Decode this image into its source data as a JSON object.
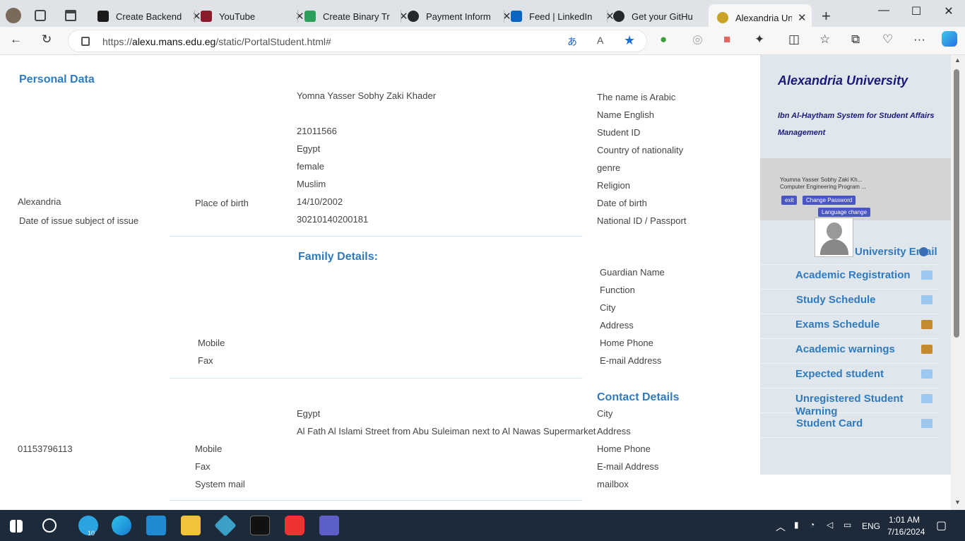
{
  "browser": {
    "tabs": [
      {
        "label": "Create Backend",
        "color": "#1b1b1b"
      },
      {
        "label": "YouTube",
        "color": "#e02020"
      },
      {
        "label": "Create Binary Tr",
        "color": "#2f9e5a"
      },
      {
        "label": "Payment Inform",
        "color": "#24292e"
      },
      {
        "label": "Feed | LinkedIn",
        "color": "#0a66c2"
      },
      {
        "label": "Get your GitHu",
        "color": "#24292e"
      },
      {
        "label": "Alexandria Univ",
        "color": "#c9a227"
      }
    ],
    "url_host": "alexu.mans.edu.eg",
    "url_prefix": "https://",
    "url_path": "/static/PortalStudent.html#"
  },
  "personal": {
    "heading": "Personal Data",
    "name_ar_value": "Yomna Yasser Sobhy Zaki Khader",
    "student_id": "21011566",
    "nationality": "Egypt",
    "gender": "female",
    "religion": "Muslim",
    "birth_date": "14/10/2002",
    "national_id": "30210140200181",
    "place_of_birth_value": "Alexandria",
    "labels": {
      "name_ar": "The name is Arabic",
      "name_en": "Name English",
      "student_id": "Student ID",
      "nationality": "Country of nationality",
      "genre": "genre",
      "religion": "Religion",
      "birth_date": "Date of birth",
      "national_id": "National ID / Passport",
      "place_of_birth": "Place of birth",
      "issue": "Date of issue subject of issue"
    }
  },
  "family": {
    "heading": "Family Details:",
    "labels": {
      "guardian": "Guardian Name",
      "function": "Function",
      "city": "City",
      "address": "Address",
      "home_phone": "Home Phone",
      "email": "E-mail Address",
      "mobile": "Mobile",
      "fax": "Fax"
    }
  },
  "contact": {
    "heading": "Contact Details",
    "city_value": "Egypt",
    "address_value": "Al Fath Al Islami Street from Abu Suleiman next to Al Nawas Supermarket",
    "mobile_value": "01153796113",
    "labels": {
      "city": "City",
      "address": "Address",
      "home_phone": "Home Phone",
      "email": "E-mail Address",
      "mailbox": "mailbox",
      "mobile": "Mobile",
      "fax": "Fax",
      "system_mail": "System mail"
    }
  },
  "sidebar": {
    "university": "Alexandria University",
    "system": "Ibn Al-Haytham System for Student Affairs Management",
    "user_name": "Youmna Yasser Sobhy Zaki Kh...",
    "program": "Computer Engineering Program ...",
    "exit": "exit",
    "change_password": "Change Password",
    "language": "Language change",
    "menu": [
      {
        "label": "University Email",
        "icon": "#3b6fb5"
      },
      {
        "label": "Academic Registration",
        "icon": "#9cc8ef"
      },
      {
        "label": "Study Schedule",
        "icon": "#9cc8ef"
      },
      {
        "label": "Exams Schedule",
        "icon": "#c58a2d"
      },
      {
        "label": "Academic warnings",
        "icon": "#c58a2d"
      },
      {
        "label": "Expected student",
        "icon": "#9cc8ef"
      },
      {
        "label": "Unregistered Student Warning",
        "icon": "#9cc8ef"
      },
      {
        "label": "Student Card",
        "icon": "#9cc8ef"
      }
    ]
  },
  "taskbar": {
    "lang": "ENG",
    "time": "1:01 AM",
    "date": "7/16/2024",
    "telegram_badge": "10"
  }
}
